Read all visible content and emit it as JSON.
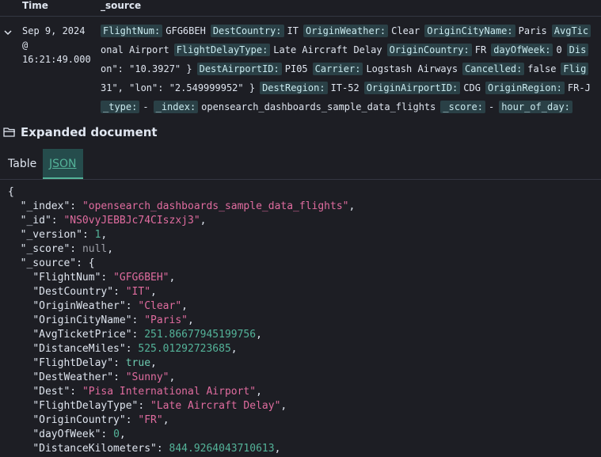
{
  "table_header": {
    "time": "Time",
    "source": "_source"
  },
  "doc_row": {
    "time_date": "Sep 9, 2024",
    "time_at": "@",
    "time_clock": "16:21:49.000",
    "lines": [
      [
        {
          "k": "FlightNum:",
          "v": "GFG6BEH"
        },
        {
          "k": "DestCountry:",
          "v": "IT"
        },
        {
          "k": "OriginWeather:",
          "v": "Clear"
        },
        {
          "k": "OriginCityName:",
          "v": "Paris"
        },
        {
          "k": "AvgTic",
          "v": ""
        }
      ],
      [
        {
          "k": "",
          "v": "onal Airport"
        },
        {
          "k": "FlightDelayType:",
          "v": "Late Aircraft Delay"
        },
        {
          "k": "OriginCountry:",
          "v": "FR"
        },
        {
          "k": "dayOfWeek:",
          "v": "0"
        },
        {
          "k": "Dis",
          "v": ""
        }
      ],
      [
        {
          "k": "",
          "v": "on\": \"10.3927\" }"
        },
        {
          "k": "DestAirportID:",
          "v": "PI05"
        },
        {
          "k": "Carrier:",
          "v": "Logstash Airways"
        },
        {
          "k": "Cancelled:",
          "v": "false"
        },
        {
          "k": "Flig",
          "v": ""
        }
      ],
      [
        {
          "k": "",
          "v": "31\", \"lon\": \"2.549999952\" }"
        },
        {
          "k": "DestRegion:",
          "v": "IT-52"
        },
        {
          "k": "OriginAirportID:",
          "v": "CDG"
        },
        {
          "k": "OriginRegion:",
          "v": "FR-J"
        }
      ],
      [
        {
          "k": "_type:",
          "v": "-"
        },
        {
          "k": "_index:",
          "v": "opensearch_dashboards_sample_data_flights"
        },
        {
          "k": "_score:",
          "v": "-"
        },
        {
          "k": "hour_of_day:",
          "v": ""
        }
      ]
    ]
  },
  "expanded": {
    "title": "Expanded document"
  },
  "tabs": {
    "table": "Table",
    "json": "JSON"
  },
  "json_lines": [
    {
      "indent": "",
      "parts": [
        {
          "t": "p",
          "s": "{"
        }
      ]
    },
    {
      "indent": "  ",
      "parts": [
        {
          "t": "k",
          "s": "\"_index\""
        },
        {
          "t": "p",
          "s": ": "
        },
        {
          "t": "s",
          "s": "\"opensearch_dashboards_sample_data_flights\""
        },
        {
          "t": "p",
          "s": ","
        }
      ]
    },
    {
      "indent": "  ",
      "parts": [
        {
          "t": "k",
          "s": "\"_id\""
        },
        {
          "t": "p",
          "s": ": "
        },
        {
          "t": "s",
          "s": "\"NS0vyJEBBJc74CIszxj3\""
        },
        {
          "t": "p",
          "s": ","
        }
      ]
    },
    {
      "indent": "  ",
      "parts": [
        {
          "t": "k",
          "s": "\"_version\""
        },
        {
          "t": "p",
          "s": ": "
        },
        {
          "t": "n",
          "s": "1"
        },
        {
          "t": "p",
          "s": ","
        }
      ]
    },
    {
      "indent": "  ",
      "parts": [
        {
          "t": "k",
          "s": "\"_score\""
        },
        {
          "t": "p",
          "s": ": "
        },
        {
          "t": "null",
          "s": "null"
        },
        {
          "t": "p",
          "s": ","
        }
      ]
    },
    {
      "indent": "  ",
      "parts": [
        {
          "t": "k",
          "s": "\"_source\""
        },
        {
          "t": "p",
          "s": ": {"
        }
      ]
    },
    {
      "indent": "    ",
      "parts": [
        {
          "t": "k",
          "s": "\"FlightNum\""
        },
        {
          "t": "p",
          "s": ": "
        },
        {
          "t": "s",
          "s": "\"GFG6BEH\""
        },
        {
          "t": "p",
          "s": ","
        }
      ]
    },
    {
      "indent": "    ",
      "parts": [
        {
          "t": "k",
          "s": "\"DestCountry\""
        },
        {
          "t": "p",
          "s": ": "
        },
        {
          "t": "s",
          "s": "\"IT\""
        },
        {
          "t": "p",
          "s": ","
        }
      ]
    },
    {
      "indent": "    ",
      "parts": [
        {
          "t": "k",
          "s": "\"OriginWeather\""
        },
        {
          "t": "p",
          "s": ": "
        },
        {
          "t": "s",
          "s": "\"Clear\""
        },
        {
          "t": "p",
          "s": ","
        }
      ]
    },
    {
      "indent": "    ",
      "parts": [
        {
          "t": "k",
          "s": "\"OriginCityName\""
        },
        {
          "t": "p",
          "s": ": "
        },
        {
          "t": "s",
          "s": "\"Paris\""
        },
        {
          "t": "p",
          "s": ","
        }
      ]
    },
    {
      "indent": "    ",
      "parts": [
        {
          "t": "k",
          "s": "\"AvgTicketPrice\""
        },
        {
          "t": "p",
          "s": ": "
        },
        {
          "t": "n",
          "s": "251.86677945199756"
        },
        {
          "t": "p",
          "s": ","
        }
      ]
    },
    {
      "indent": "    ",
      "parts": [
        {
          "t": "k",
          "s": "\"DistanceMiles\""
        },
        {
          "t": "p",
          "s": ": "
        },
        {
          "t": "n",
          "s": "525.01292723685"
        },
        {
          "t": "p",
          "s": ","
        }
      ]
    },
    {
      "indent": "    ",
      "parts": [
        {
          "t": "k",
          "s": "\"FlightDelay\""
        },
        {
          "t": "p",
          "s": ": "
        },
        {
          "t": "b",
          "s": "true"
        },
        {
          "t": "p",
          "s": ","
        }
      ]
    },
    {
      "indent": "    ",
      "parts": [
        {
          "t": "k",
          "s": "\"DestWeather\""
        },
        {
          "t": "p",
          "s": ": "
        },
        {
          "t": "s",
          "s": "\"Sunny\""
        },
        {
          "t": "p",
          "s": ","
        }
      ]
    },
    {
      "indent": "    ",
      "parts": [
        {
          "t": "k",
          "s": "\"Dest\""
        },
        {
          "t": "p",
          "s": ": "
        },
        {
          "t": "s",
          "s": "\"Pisa International Airport\""
        },
        {
          "t": "p",
          "s": ","
        }
      ]
    },
    {
      "indent": "    ",
      "parts": [
        {
          "t": "k",
          "s": "\"FlightDelayType\""
        },
        {
          "t": "p",
          "s": ": "
        },
        {
          "t": "s",
          "s": "\"Late Aircraft Delay\""
        },
        {
          "t": "p",
          "s": ","
        }
      ]
    },
    {
      "indent": "    ",
      "parts": [
        {
          "t": "k",
          "s": "\"OriginCountry\""
        },
        {
          "t": "p",
          "s": ": "
        },
        {
          "t": "s",
          "s": "\"FR\""
        },
        {
          "t": "p",
          "s": ","
        }
      ]
    },
    {
      "indent": "    ",
      "parts": [
        {
          "t": "k",
          "s": "\"dayOfWeek\""
        },
        {
          "t": "p",
          "s": ": "
        },
        {
          "t": "n",
          "s": "0"
        },
        {
          "t": "p",
          "s": ","
        }
      ]
    },
    {
      "indent": "    ",
      "parts": [
        {
          "t": "k",
          "s": "\"DistanceKilometers\""
        },
        {
          "t": "p",
          "s": ": "
        },
        {
          "t": "n",
          "s": "844.9264043710613"
        },
        {
          "t": "p",
          "s": ","
        }
      ]
    }
  ]
}
